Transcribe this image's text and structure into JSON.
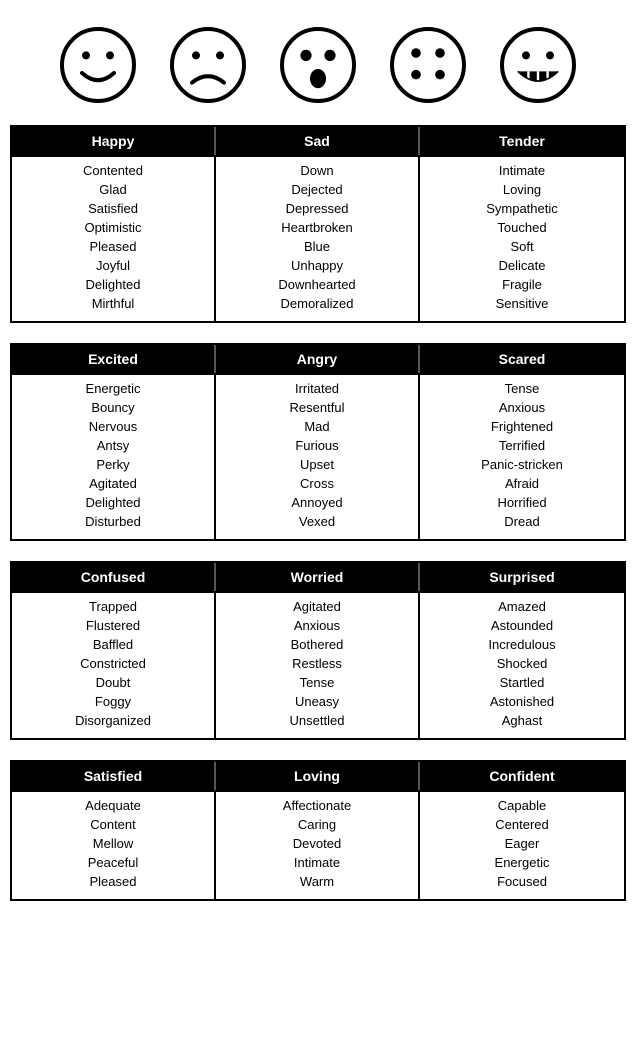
{
  "emojis": [
    {
      "name": "happy",
      "label": "happy smiley"
    },
    {
      "name": "sad",
      "label": "sad face"
    },
    {
      "name": "surprised",
      "label": "surprised face"
    },
    {
      "name": "confused",
      "label": "confused dots face"
    },
    {
      "name": "grinning",
      "label": "grinning teeth face"
    }
  ],
  "sections": [
    {
      "id": "section1",
      "columns": [
        {
          "header": "Happy",
          "items": [
            "Contented",
            "Glad",
            "Satisfied",
            "Optimistic",
            "Pleased",
            "Joyful",
            "Delighted",
            "Mirthful"
          ]
        },
        {
          "header": "Sad",
          "items": [
            "Down",
            "Dejected",
            "Depressed",
            "Heartbroken",
            "Blue",
            "Unhappy",
            "Downhearted",
            "Demoralized"
          ]
        },
        {
          "header": "Tender",
          "items": [
            "Intimate",
            "Loving",
            "Sympathetic",
            "Touched",
            "Soft",
            "Delicate",
            "Fragile",
            "Sensitive"
          ]
        }
      ]
    },
    {
      "id": "section2",
      "columns": [
        {
          "header": "Excited",
          "items": [
            "Energetic",
            "Bouncy",
            "Nervous",
            "Antsy",
            "Perky",
            "Agitated",
            "Delighted",
            "Disturbed"
          ]
        },
        {
          "header": "Angry",
          "items": [
            "Irritated",
            "Resentful",
            "Mad",
            "Furious",
            "Upset",
            "Cross",
            "Annoyed",
            "Vexed"
          ]
        },
        {
          "header": "Scared",
          "items": [
            "Tense",
            "Anxious",
            "Frightened",
            "Terrified",
            "Panic-stricken",
            "Afraid",
            "Horrified",
            "Dread"
          ]
        }
      ]
    },
    {
      "id": "section3",
      "columns": [
        {
          "header": "Confused",
          "items": [
            "Trapped",
            "Flustered",
            "Baffled",
            "Constricted",
            "Doubt",
            "Foggy",
            "Disorganized"
          ]
        },
        {
          "header": "Worried",
          "items": [
            "Agitated",
            "Anxious",
            "Bothered",
            "Restless",
            "Tense",
            "Uneasy",
            "Unsettled"
          ]
        },
        {
          "header": "Surprised",
          "items": [
            "Amazed",
            "Astounded",
            "Incredulous",
            "Shocked",
            "Startled",
            "Astonished",
            "Aghast"
          ]
        }
      ]
    },
    {
      "id": "section4",
      "columns": [
        {
          "header": "Satisfied",
          "items": [
            "Adequate",
            "Content",
            "Mellow",
            "Peaceful",
            "Pleased"
          ]
        },
        {
          "header": "Loving",
          "items": [
            "Affectionate",
            "Caring",
            "Devoted",
            "Intimate",
            "Warm"
          ]
        },
        {
          "header": "Confident",
          "items": [
            "Capable",
            "Centered",
            "Eager",
            "Energetic",
            "Focused"
          ]
        }
      ]
    }
  ]
}
